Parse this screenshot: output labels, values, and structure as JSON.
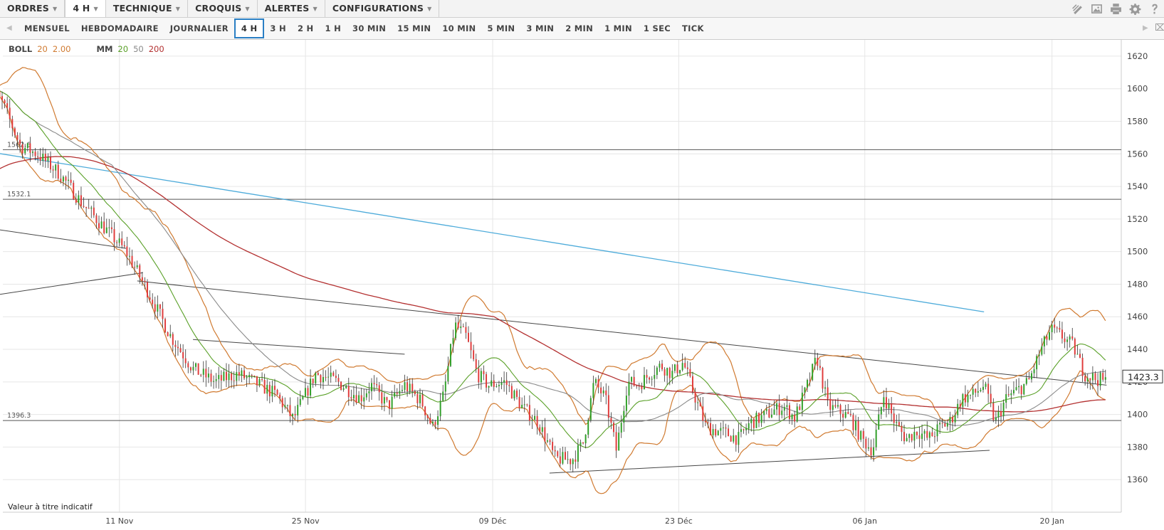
{
  "menubar": {
    "items": [
      {
        "label": "ORDRES",
        "caret": true,
        "active": false
      },
      {
        "label": "4 H",
        "caret": true,
        "active": true
      },
      {
        "label": "TECHNIQUE",
        "caret": true,
        "active": false
      },
      {
        "label": "CROQUIS",
        "caret": true,
        "active": false
      },
      {
        "label": "ALERTES",
        "caret": true,
        "active": false
      },
      {
        "label": "CONFIGURATIONS",
        "caret": true,
        "active": false
      }
    ],
    "tool_icons": [
      "drawing-tools-icon",
      "image-icon",
      "print-icon",
      "gear-icon",
      "help-icon"
    ]
  },
  "timeframes": {
    "items": [
      "MENSUEL",
      "HEBDOMADAIRE",
      "JOURNALIER",
      "4 H",
      "3 H",
      "2 H",
      "1 H",
      "30 MIN",
      "15 MIN",
      "10 MIN",
      "5 MIN",
      "3 MIN",
      "2 MIN",
      "1 MIN",
      "1 SEC",
      "TICK"
    ],
    "selected": "4 H"
  },
  "legend": {
    "boll": {
      "label": "BOLL",
      "period": "20",
      "stddev": "2.00"
    },
    "mm": {
      "label": "MM",
      "p1": "20",
      "p2": "50",
      "p3": "200"
    }
  },
  "disclaimer": "Valeur à titre indicatif",
  "colors": {
    "up": "#2e9e27",
    "down": "#e03a3a",
    "boll": "#d07a30",
    "ma20": "#5aa028",
    "ma50": "#8a8a8a",
    "ma200": "#b33030",
    "trend_blue": "#3aa2d6",
    "trend": "#333333"
  },
  "chart_data": {
    "type": "candlestick",
    "y_ticks": [
      1360,
      1380,
      1400,
      1420,
      1440,
      1460,
      1480,
      1500,
      1520,
      1540,
      1560,
      1580,
      1600,
      1620
    ],
    "ylim": [
      1340,
      1630
    ],
    "x_range": [
      0,
      100
    ],
    "x_ticks": [
      {
        "label": "11 Nov",
        "x": 10.4
      },
      {
        "label": "25 Nov",
        "x": 27.1
      },
      {
        "label": "09 Déc",
        "x": 43.9
      },
      {
        "label": "23 Déc",
        "x": 60.6
      },
      {
        "label": "06 Jan",
        "x": 77.3
      },
      {
        "label": "20 Jan",
        "x": 94.1
      }
    ],
    "last_price": "1423.3",
    "level_lines": [
      {
        "value": 1562.6,
        "label": "1562.6"
      },
      {
        "value": 1532.1,
        "label": "1532.1"
      },
      {
        "value": 1396.3,
        "label": "1396.3"
      }
    ],
    "trendlines": [
      {
        "color": "blue",
        "x": [
          -2,
          88
        ],
        "y": [
          1562,
          1463
        ]
      },
      {
        "color": "dark",
        "x": [
          -2,
          11
        ],
        "y": [
          1515,
          1502
        ]
      },
      {
        "color": "dark",
        "x": [
          -2,
          12.5
        ],
        "y": [
          1472,
          1487
        ]
      },
      {
        "color": "dark",
        "x": [
          12,
          99
        ],
        "y": [
          1482,
          1418
        ]
      },
      {
        "color": "dark",
        "x": [
          17,
          36
        ],
        "y": [
          1446,
          1437
        ]
      },
      {
        "color": "dark",
        "x": [
          49,
          88.5
        ],
        "y": [
          1364,
          1378
        ]
      }
    ],
    "price_path": {
      "x": [
        -2,
        0,
        1.5,
        3,
        5,
        7,
        9,
        11,
        13,
        15,
        17,
        19,
        21,
        23,
        24.5,
        26,
        28,
        30,
        32,
        33,
        34.5,
        36,
        37.5,
        38.5,
        39.5,
        40.5,
        41.5,
        42.5,
        43.5,
        45,
        46.5,
        48,
        49.5,
        51,
        52,
        53,
        54,
        55,
        56,
        57,
        58,
        59,
        60,
        61,
        62,
        63,
        64,
        65,
        66,
        67,
        68,
        69,
        70,
        71,
        72,
        73,
        74,
        75,
        76,
        77,
        78,
        79,
        80,
        81,
        82,
        83,
        84,
        85,
        86,
        87,
        88,
        89,
        90,
        91,
        92,
        93,
        94,
        95,
        96,
        97,
        98,
        99
      ],
      "close": [
        1610,
        1590,
        1565,
        1560,
        1548,
        1530,
        1515,
        1500,
        1475,
        1448,
        1428,
        1420,
        1425,
        1418,
        1412,
        1397,
        1425,
        1420,
        1410,
        1418,
        1405,
        1418,
        1408,
        1392,
        1412,
        1455,
        1448,
        1425,
        1418,
        1420,
        1405,
        1395,
        1373,
        1372,
        1382,
        1420,
        1410,
        1378,
        1420,
        1418,
        1425,
        1430,
        1425,
        1432,
        1412,
        1393,
        1390,
        1388,
        1385,
        1395,
        1398,
        1402,
        1405,
        1398,
        1415,
        1435,
        1405,
        1402,
        1398,
        1385,
        1378,
        1412,
        1395,
        1385,
        1390,
        1385,
        1392,
        1396,
        1410,
        1412,
        1418,
        1395,
        1410,
        1415,
        1420,
        1438,
        1452,
        1448,
        1442,
        1425,
        1422,
        1420
      ]
    }
  }
}
